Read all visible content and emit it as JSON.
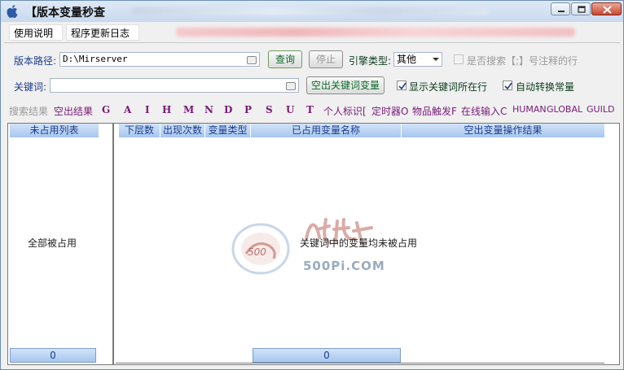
{
  "window": {
    "title": "【版本变量秒查",
    "controls": {
      "minimize": "minimize",
      "maximize": "maximize",
      "close": "close"
    }
  },
  "menu": {
    "items": [
      "使用说明",
      "程序更新日志"
    ]
  },
  "path_row": {
    "label": "版本路径:",
    "value": "D:\\Mirserver",
    "query_button": "查询",
    "stop_button": "停止",
    "engine_label": "引擎类型:",
    "engine_value": "其他",
    "search_comment_label": "是否搜索【;】号注释的行",
    "search_comment_checked": false
  },
  "keyword_row": {
    "label": "关键词:",
    "value": "",
    "empty_button": "空出关键词变量",
    "show_line_label": "显示关键词所在行",
    "show_line_checked": true,
    "auto_convert_label": "自动转换常量",
    "auto_convert_checked": true
  },
  "filters": {
    "search_result_label": "搜索结果",
    "items": [
      "空出结果",
      "G",
      "A",
      "I",
      "H",
      "M",
      "N",
      "D",
      "P",
      "S",
      "U",
      "T",
      "个人标识[",
      "定时器O",
      "物品触发F",
      "在线输入C",
      "HUMAN",
      "GLOBAL",
      "GUILD"
    ]
  },
  "left_panel": {
    "header": "未占用列表",
    "message": "全部被占用",
    "count": "0"
  },
  "right_panel": {
    "columns": [
      "下层数",
      "出现次数",
      "变量类型",
      "已占用变量名称",
      "空出变量操作结果"
    ],
    "message": "关键词中的变量均未被占用",
    "count": "0"
  },
  "watermark": {
    "text": "500Pi.COM"
  },
  "colors": {
    "accent": "#1b3d8f",
    "button_text": "#0a6a2a",
    "filter_text": "#7a1a7a",
    "header_bg": "#a7c6ee"
  }
}
